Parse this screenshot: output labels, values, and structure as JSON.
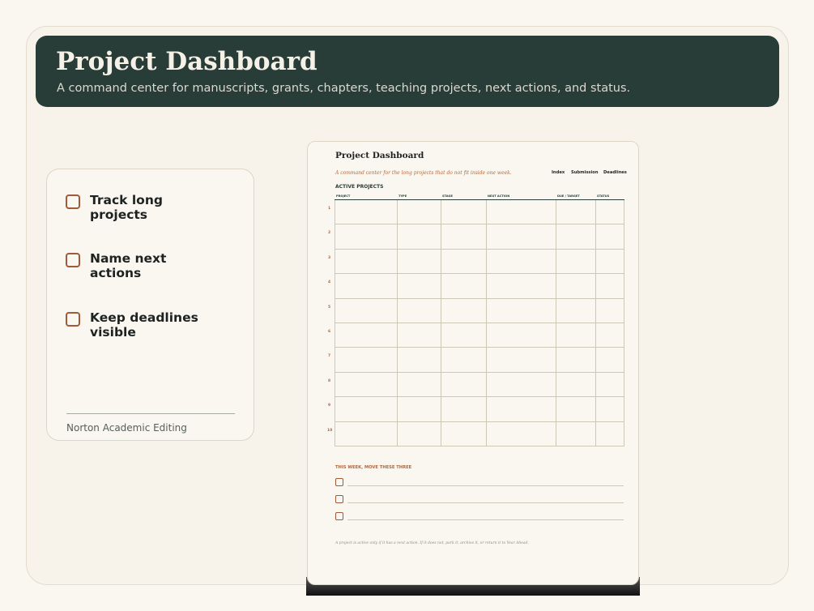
{
  "hero": {
    "title": "Project Dashboard",
    "subtitle": "A command center for manuscripts, grants, chapters, teaching projects, next actions, and status."
  },
  "features": {
    "items": [
      {
        "label": "Track long projects"
      },
      {
        "label": "Name next actions"
      },
      {
        "label": "Keep deadlines visible"
      }
    ],
    "brand": "Norton Academic Editing"
  },
  "sheet": {
    "title": "Project Dashboard",
    "subtitle": "A command center for the long projects that do not fit inside one week.",
    "nav": [
      "Index",
      "Submission",
      "Deadlines"
    ],
    "section_active": "ACTIVE PROJECTS",
    "columns": [
      "PROJECT",
      "TYPE",
      "STAGE",
      "NEXT ACTION",
      "DUE / TARGET",
      "STATUS"
    ],
    "row_numbers": [
      "1",
      "2",
      "3",
      "4",
      "5",
      "6",
      "7",
      "8",
      "9",
      "10"
    ],
    "section_week": "THIS WEEK, MOVE THESE THREE",
    "note": "A project is active only if it has a next action. If it does not, park it, archive it, or return it to Year Ahead."
  },
  "colors": {
    "hero_bg": "#283d38",
    "accent": "#a05a3a",
    "background": "#faf7f0"
  }
}
